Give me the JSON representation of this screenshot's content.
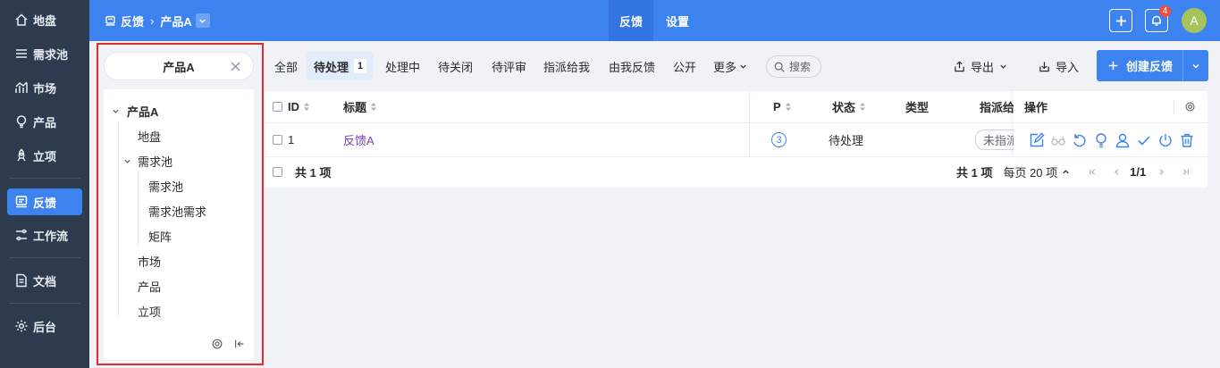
{
  "nav": {
    "items": [
      {
        "label": "地盘",
        "icon": "home-icon"
      },
      {
        "label": "需求池",
        "icon": "list-icon"
      },
      {
        "label": "市场",
        "icon": "chart-icon"
      },
      {
        "label": "产品",
        "icon": "bulb-icon"
      },
      {
        "label": "立项",
        "icon": "rocket-icon"
      },
      {
        "label": "反馈",
        "icon": "feedback-icon"
      },
      {
        "label": "工作流",
        "icon": "workflow-icon"
      },
      {
        "label": "文档",
        "icon": "doc-icon"
      },
      {
        "label": "后台",
        "icon": "gear-icon"
      }
    ]
  },
  "topbar": {
    "breadcrumb_root": "反馈",
    "breadcrumb_product": "产品A",
    "tabs": [
      "反馈",
      "设置"
    ],
    "notification_count": "4",
    "avatar_letter": "A"
  },
  "tree": {
    "search_value": "产品A",
    "nodes": [
      "产品A",
      "地盘",
      "需求池",
      "需求池",
      "需求池需求",
      "矩阵",
      "市场",
      "产品",
      "立项"
    ]
  },
  "filters": {
    "tabs": [
      "全部",
      "待处理",
      "处理中",
      "待关闭",
      "待评审",
      "指派给我",
      "由我反馈",
      "公开"
    ],
    "pending_count": "1",
    "more_label": "更多",
    "search_placeholder": "搜索",
    "export_label": "导出",
    "import_label": "导入",
    "create_label": "创建反馈"
  },
  "table": {
    "columns": [
      "ID",
      "标题",
      "P",
      "状态",
      "类型",
      "指派给",
      "操作"
    ],
    "rows": [
      {
        "id": "1",
        "title": "反馈A",
        "priority": "3",
        "status": "待处理",
        "type": "",
        "assignee": "未指派"
      }
    ],
    "footer_total": "共 1 项",
    "pager_total": "共 1 项",
    "page_size": "每页 20 项",
    "page": "1/1"
  },
  "colors": {
    "accent": "#3d83f0",
    "nav_bg": "#2e3a4d",
    "title_link": "#7a3fb3",
    "panel_border": "#e02c2c"
  }
}
